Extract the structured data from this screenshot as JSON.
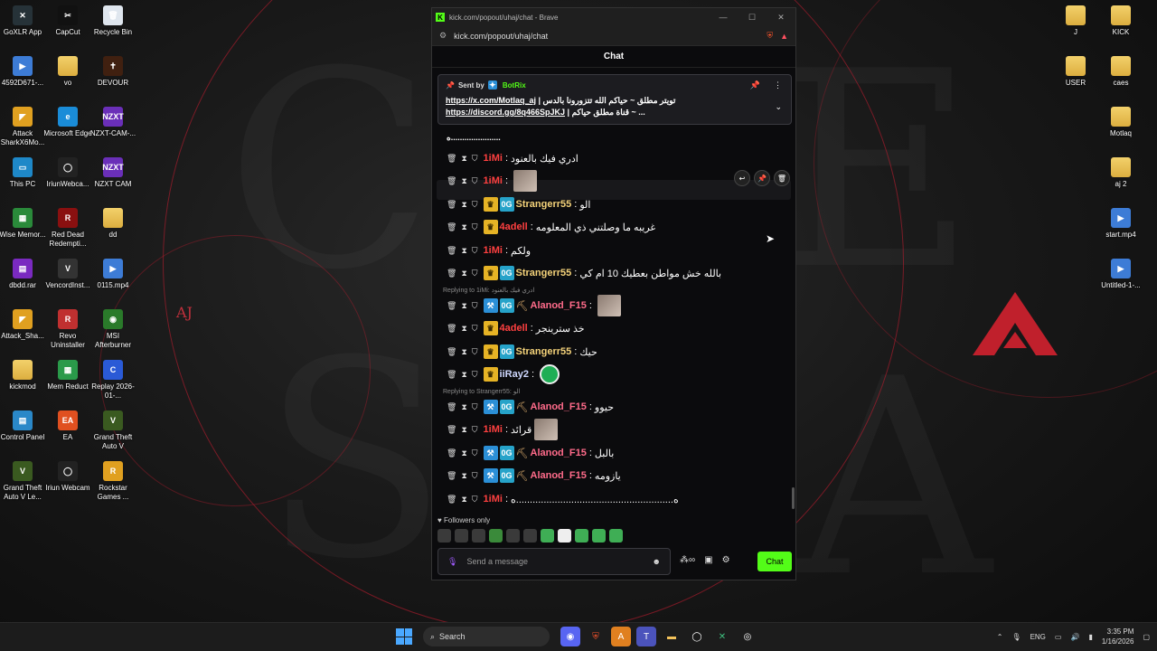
{
  "desktop_left": [
    {
      "label": "GoXLR App",
      "color": "#263238",
      "glyph": "✕"
    },
    {
      "label": "CapCut",
      "color": "#111",
      "glyph": "✂"
    },
    {
      "label": "Recycle Bin",
      "color": "#dfe6ee",
      "glyph": "🗑"
    },
    {
      "label": "4592D671-...",
      "color": "#3d7cd6",
      "glyph": "▶"
    },
    {
      "label": "vo",
      "color": "folder",
      "glyph": ""
    },
    {
      "label": "DEVOUR",
      "color": "#402010",
      "glyph": "✝"
    },
    {
      "label": "Attack SharkX6Mo...",
      "color": "#e0a020",
      "glyph": "◤"
    },
    {
      "label": "Microsoft Edge",
      "color": "#1a8cd8",
      "glyph": "e"
    },
    {
      "label": "NZXT-CAM-...",
      "color": "#6a2fb8",
      "glyph": "NZXT"
    },
    {
      "label": "This PC",
      "color": "#1e88c8",
      "glyph": "▭"
    },
    {
      "label": "IriunWebca...",
      "color": "#222",
      "glyph": "◯"
    },
    {
      "label": "NZXT CAM",
      "color": "#6a2fb8",
      "glyph": "NZXT"
    },
    {
      "label": "Wise Memor...",
      "color": "#2a8a3a",
      "glyph": "▦"
    },
    {
      "label": "Red Dead Redempti...",
      "color": "#8a1010",
      "glyph": "R"
    },
    {
      "label": "dd",
      "color": "folder",
      "glyph": ""
    },
    {
      "label": "dbdd.rar",
      "color": "#7a2ac0",
      "glyph": "▤"
    },
    {
      "label": "VencordInst...",
      "color": "#333",
      "glyph": "V"
    },
    {
      "label": "0115.mp4",
      "color": "#3d7cd6",
      "glyph": "▶"
    },
    {
      "label": "Attack_Sha...",
      "color": "#e0a020",
      "glyph": "◤"
    },
    {
      "label": "Revo Uninstaller",
      "color": "#c03030",
      "glyph": "R"
    },
    {
      "label": "MSI Afterburner",
      "color": "#2a7a2a",
      "glyph": "◉"
    },
    {
      "label": "kickmod",
      "color": "folder",
      "glyph": ""
    },
    {
      "label": "Mem Reduct",
      "color": "#2a9a4a",
      "glyph": "▦"
    },
    {
      "label": "Replay 2026-01-...",
      "color": "#2a5ad6",
      "glyph": "C"
    },
    {
      "label": "Control Panel",
      "color": "#2a88c8",
      "glyph": "▤"
    },
    {
      "label": "EA",
      "color": "#e05020",
      "glyph": "EA"
    },
    {
      "label": "Grand Theft Auto V",
      "color": "#3a5a20",
      "glyph": "V"
    },
    {
      "label": "Grand Theft Auto V Le...",
      "color": "#3a5a20",
      "glyph": "V"
    },
    {
      "label": "Iriun Webcam",
      "color": "#222",
      "glyph": "◯"
    },
    {
      "label": "Rockstar Games ...",
      "color": "#e0a020",
      "glyph": "R"
    }
  ],
  "desktop_right": [
    {
      "label": "J",
      "color": "folder",
      "glyph": ""
    },
    {
      "label": "KICK",
      "color": "folder",
      "glyph": ""
    },
    {
      "label": "USER",
      "color": "folder",
      "glyph": ""
    },
    {
      "label": "caes",
      "color": "folder",
      "glyph": ""
    },
    {
      "label": "Motlaq",
      "color": "folder",
      "glyph": ""
    },
    {
      "label": "aj 2",
      "color": "folder",
      "glyph": ""
    },
    {
      "label": "start.mp4",
      "color": "#3d7cd6",
      "glyph": "▶"
    },
    {
      "label": "Untitled-1-...",
      "color": "#3d7cd6",
      "glyph": "▶"
    }
  ],
  "wallpaper": {
    "aj": "AJ"
  },
  "browser": {
    "title": "kick.com/popout/uhaj/chat - Brave",
    "url": "kick.com/popout/uhaj/chat"
  },
  "chat": {
    "header": "Chat",
    "pinned": {
      "sent_by": "Sent by",
      "bot": "BotRix",
      "line1_link": "https://x.com/Motlaq_aj",
      "line1_text": " | تويتر مطلق ~ حياكم الله تتزورونا بالدس",
      "line2_link": "https://discord.gg/8q466SpJKJ",
      "line2_text": " | قناة مطلق حياكم ~ ..."
    },
    "top_line": "ه......................",
    "messages": [
      {
        "user": "1iMi",
        "color": "#ff4040",
        "badges": [],
        "text": "ادري فيك بالعنود"
      },
      {
        "user": "1iMi",
        "color": "#ff4040",
        "badges": [],
        "text": "",
        "thumb": true
      },
      {
        "user": "Strangerr55",
        "color": "#f5d37a",
        "badges": [
          "crown",
          "og"
        ],
        "text": "الو"
      },
      {
        "user": "4adell",
        "color": "#ff4040",
        "badges": [
          "crown"
        ],
        "text": "غريبه ما وصلتني ذي المعلومه"
      },
      {
        "user": "1iMi",
        "color": "#ff4040",
        "badges": [],
        "text": "ولكم"
      },
      {
        "user": "Strangerr55",
        "color": "#f5d37a",
        "badges": [
          "crown",
          "og"
        ],
        "text": "بالله خش مواطن بعطيك 10 ام كي"
      },
      {
        "user": "Alanod_F15",
        "color": "#ff6b8a",
        "badges": [
          "vip",
          "og",
          "pick"
        ],
        "text": "",
        "thumb": true,
        "reply": "Replying to 1iMi: ادري فيك بالعنود"
      },
      {
        "user": "4adell",
        "color": "#ff4040",
        "badges": [
          "crown"
        ],
        "text": "خذ سترينجر"
      },
      {
        "user": "Strangerr55",
        "color": "#f5d37a",
        "badges": [
          "crown",
          "og"
        ],
        "text": "حيك"
      },
      {
        "user": "iiRay2",
        "color": "#cfd8ff",
        "badges": [
          "crown"
        ],
        "text": "",
        "emote": true
      },
      {
        "user": "Alanod_F15",
        "color": "#ff6b8a",
        "badges": [
          "vip",
          "og",
          "pick"
        ],
        "text": "حيوو",
        "reply": "Replying to Strangerr55: الو"
      },
      {
        "user": "1iMi",
        "color": "#ff4040",
        "badges": [],
        "text": "قرائد",
        "thumb": true
      },
      {
        "user": "Alanod_F15",
        "color": "#ff6b8a",
        "badges": [
          "vip",
          "og",
          "pick"
        ],
        "text": "بالبل"
      },
      {
        "user": "Alanod_F15",
        "color": "#ff6b8a",
        "badges": [
          "vip",
          "og",
          "pick"
        ],
        "text": "يازومه"
      },
      {
        "user": "1iMi",
        "color": "#ff4040",
        "badges": [],
        "text": "ه.........................................................ه"
      }
    ],
    "followers_only": "Followers only",
    "input_placeholder": "Send a message",
    "send_label": "Chat"
  },
  "taskbar": {
    "search": "Search",
    "lang": "ENG",
    "time": "3:35 PM",
    "date": "1/16/2026"
  },
  "colors": {
    "kick_green": "#53fc18",
    "accent_red": "#c0303c"
  }
}
